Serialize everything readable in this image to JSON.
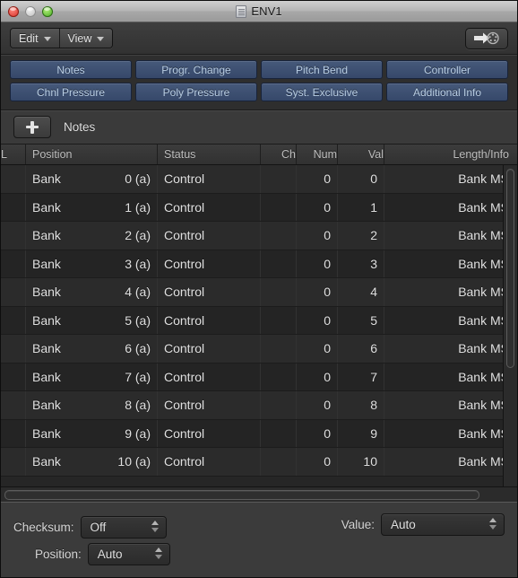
{
  "window": {
    "title": "ENV1",
    "doc_icon": "midi-document-icon",
    "traffic_lights": [
      {
        "name": "close",
        "color": "#e0443b"
      },
      {
        "name": "minimize",
        "color": "#c9c9c9"
      },
      {
        "name": "zoom",
        "color": "#5fbb35"
      }
    ]
  },
  "toolbar": {
    "menus": [
      {
        "label": "Edit",
        "icon": "chevron-down-icon"
      },
      {
        "label": "View",
        "icon": "chevron-down-icon"
      }
    ],
    "midi_out_button": "midi-out-icon"
  },
  "event_types": {
    "row1": [
      "Notes",
      "Progr. Change",
      "Pitch Bend",
      "Controller"
    ],
    "row2": [
      "Chnl Pressure",
      "Poly Pressure",
      "Syst. Exclusive",
      "Additional Info"
    ],
    "button_color": "#3c4f6b",
    "text_color": "#b9cee4"
  },
  "add_bar": {
    "add_icon": "plus-icon",
    "label": "Notes"
  },
  "list": {
    "columns": [
      "L",
      "Position",
      "Status",
      "Ch",
      "Num",
      "Val",
      "Length/Info"
    ],
    "rows": [
      {
        "l": "",
        "pos_name": "Bank",
        "pos_value": "0 (a)",
        "status": "Control",
        "ch": "",
        "num": "0",
        "val": "0",
        "length": "Bank MS"
      },
      {
        "l": "",
        "pos_name": "Bank",
        "pos_value": "1 (a)",
        "status": "Control",
        "ch": "",
        "num": "0",
        "val": "1",
        "length": "Bank MS"
      },
      {
        "l": "",
        "pos_name": "Bank",
        "pos_value": "2 (a)",
        "status": "Control",
        "ch": "",
        "num": "0",
        "val": "2",
        "length": "Bank MS"
      },
      {
        "l": "",
        "pos_name": "Bank",
        "pos_value": "3 (a)",
        "status": "Control",
        "ch": "",
        "num": "0",
        "val": "3",
        "length": "Bank MS"
      },
      {
        "l": "",
        "pos_name": "Bank",
        "pos_value": "4 (a)",
        "status": "Control",
        "ch": "",
        "num": "0",
        "val": "4",
        "length": "Bank MS"
      },
      {
        "l": "",
        "pos_name": "Bank",
        "pos_value": "5 (a)",
        "status": "Control",
        "ch": "",
        "num": "0",
        "val": "5",
        "length": "Bank MS"
      },
      {
        "l": "",
        "pos_name": "Bank",
        "pos_value": "6 (a)",
        "status": "Control",
        "ch": "",
        "num": "0",
        "val": "6",
        "length": "Bank MS"
      },
      {
        "l": "",
        "pos_name": "Bank",
        "pos_value": "7 (a)",
        "status": "Control",
        "ch": "",
        "num": "0",
        "val": "7",
        "length": "Bank MS"
      },
      {
        "l": "",
        "pos_name": "Bank",
        "pos_value": "8 (a)",
        "status": "Control",
        "ch": "",
        "num": "0",
        "val": "8",
        "length": "Bank MS"
      },
      {
        "l": "",
        "pos_name": "Bank",
        "pos_value": "9 (a)",
        "status": "Control",
        "ch": "",
        "num": "0",
        "val": "9",
        "length": "Bank MS"
      },
      {
        "l": "",
        "pos_name": "Bank",
        "pos_value": "10 (a)",
        "status": "Control",
        "ch": "",
        "num": "0",
        "val": "10",
        "length": "Bank MS"
      }
    ]
  },
  "bottom": {
    "checksum": {
      "label": "Checksum:",
      "value": "Off"
    },
    "position": {
      "label": "Position:",
      "value": "Auto"
    },
    "value": {
      "label": "Value:",
      "value": "Auto"
    }
  }
}
